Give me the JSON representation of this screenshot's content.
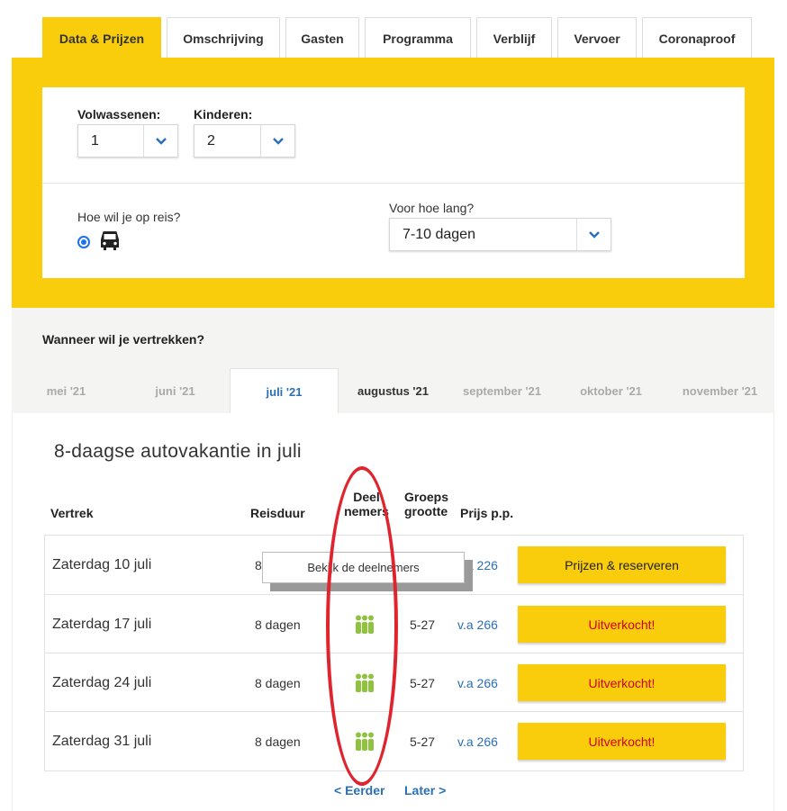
{
  "tabs": [
    "Data & Prijzen",
    "Omschrijving",
    "Gasten",
    "Programma",
    "Verblijf",
    "Vervoer",
    "Coronaproof"
  ],
  "form": {
    "adults_label": "Volwassenen:",
    "adults_value": "1",
    "children_label": "Kinderen:",
    "children_value": "2",
    "travel_label": "Hoe wil je op reis?",
    "duration_label": "Voor hoe lang?",
    "duration_value": "7-10 dagen"
  },
  "when_label": "Wanneer wil je vertrekken?",
  "months": [
    "mei '21",
    "juni '21",
    "juli '21",
    "augustus '21",
    "september '21",
    "oktober '21",
    "november '21"
  ],
  "active_month": "juli '21",
  "results": {
    "title": "8-daagse autovakantie in juli",
    "headers": {
      "vertrek": "Vertrek",
      "reisduur": "Reisduur",
      "deelnemers_1": "Deel",
      "deelnemers_2": "nemers",
      "groep_1": "Groeps",
      "groep_2": "grootte",
      "prijs": "Prijs p.p."
    },
    "rows": [
      {
        "date": "Zaterdag 10 juli",
        "duration": "8",
        "group": "",
        "price": "v.a 226",
        "button": "Prijzen & reserveren"
      },
      {
        "date": "Zaterdag 17 juli",
        "duration": "8 dagen",
        "group": "5-27",
        "price": "v.a 266",
        "button": "Uitverkocht!"
      },
      {
        "date": "Zaterdag 24 juli",
        "duration": "8 dagen",
        "group": "5-27",
        "price": "v.a 266",
        "button": "Uitverkocht!"
      },
      {
        "date": "Zaterdag 31 juli",
        "duration": "8 dagen",
        "group": "5-27",
        "price": "v.a 266",
        "button": "Uitverkocht!"
      }
    ],
    "tooltip": "Bekijk de deelnemers",
    "earlier": "< Eerder",
    "later": "Later >"
  },
  "colors": {
    "accent": "#f9cd0b",
    "link": "#2b6fb6",
    "soldout": "#d0021b",
    "people_icon": "#8fc23f",
    "annotation": "#e0242e"
  },
  "icons": {
    "chevron": "chevron-down-icon",
    "car": "car-icon",
    "people": "people-icon"
  }
}
